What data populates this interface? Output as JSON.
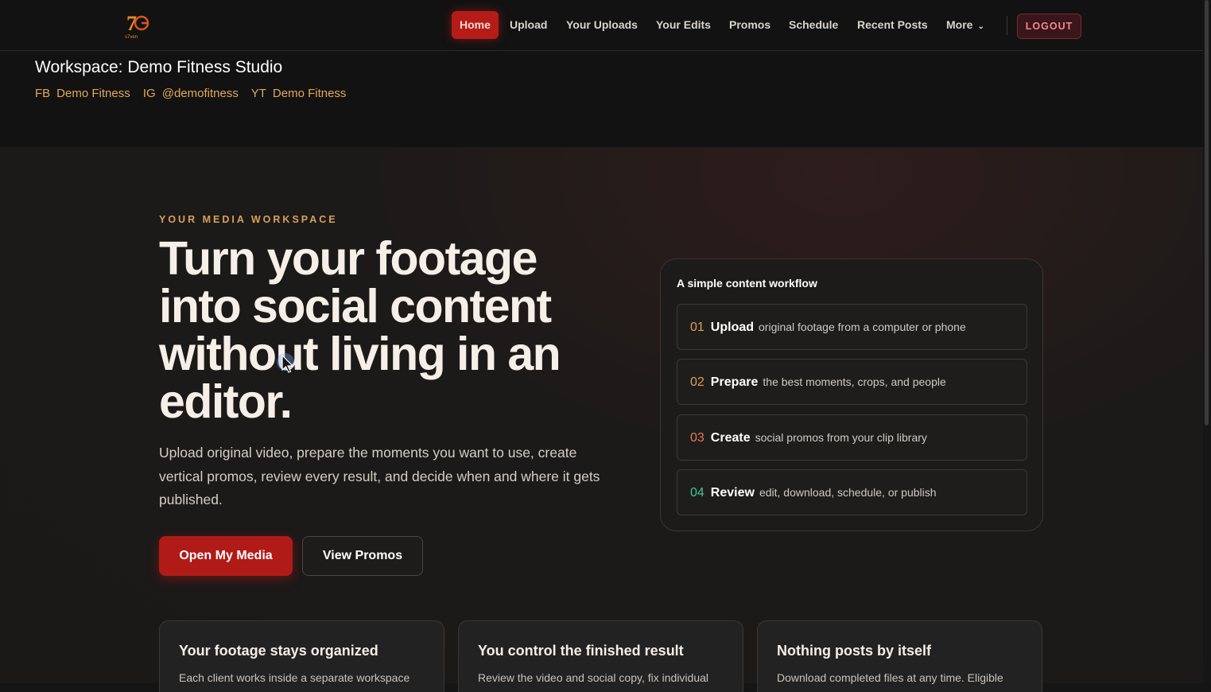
{
  "nav": {
    "logo_text": "s7ven",
    "items": [
      {
        "label": "Home",
        "active": true
      },
      {
        "label": "Upload",
        "active": false
      },
      {
        "label": "Your Uploads",
        "active": false
      },
      {
        "label": "Your Edits",
        "active": false
      },
      {
        "label": "Promos",
        "active": false
      },
      {
        "label": "Schedule",
        "active": false
      },
      {
        "label": "Recent Posts",
        "active": false
      },
      {
        "label": "More",
        "active": false
      }
    ],
    "logout": "LOGOUT"
  },
  "workspace": {
    "title": "Workspace: Demo Fitness Studio",
    "accounts": [
      {
        "platform": "FB",
        "handle": "Demo Fitness"
      },
      {
        "platform": "IG",
        "handle": "@demofitness"
      },
      {
        "platform": "YT",
        "handle": "Demo Fitness"
      }
    ]
  },
  "hero": {
    "eyebrow": "YOUR MEDIA WORKSPACE",
    "headline": "Turn your footage into social content without living in an editor.",
    "subcopy": "Upload original video, prepare the moments you want to use, create vertical promos, review every result, and decide when and where it gets published.",
    "primary_button": "Open My Media",
    "secondary_button": "View Promos"
  },
  "workflow": {
    "title": "A simple content workflow",
    "steps": [
      {
        "num": "01",
        "name": "Upload",
        "desc": "original footage from a computer or phone",
        "color": "#d9a05a"
      },
      {
        "num": "02",
        "name": "Prepare",
        "desc": "the best moments, crops, and people",
        "color": "#d9a05a"
      },
      {
        "num": "03",
        "name": "Create",
        "desc": "social promos from your clip library",
        "color": "#e07a55"
      },
      {
        "num": "04",
        "name": "Review",
        "desc": "edit, download, schedule, or publish",
        "color": "#3fc39a"
      }
    ]
  },
  "cards": [
    {
      "title": "Your footage stays organized",
      "text": "Each client works inside a separate workspace"
    },
    {
      "title": "You control the finished result",
      "text": "Review the video and social copy, fix individual"
    },
    {
      "title": "Nothing posts by itself",
      "text": "Download completed files at any time. Eligible"
    }
  ],
  "colors": {
    "accent": "#b01b17",
    "gold": "#d9a05a",
    "teal": "#3fc39a",
    "background": "#1b1918"
  }
}
